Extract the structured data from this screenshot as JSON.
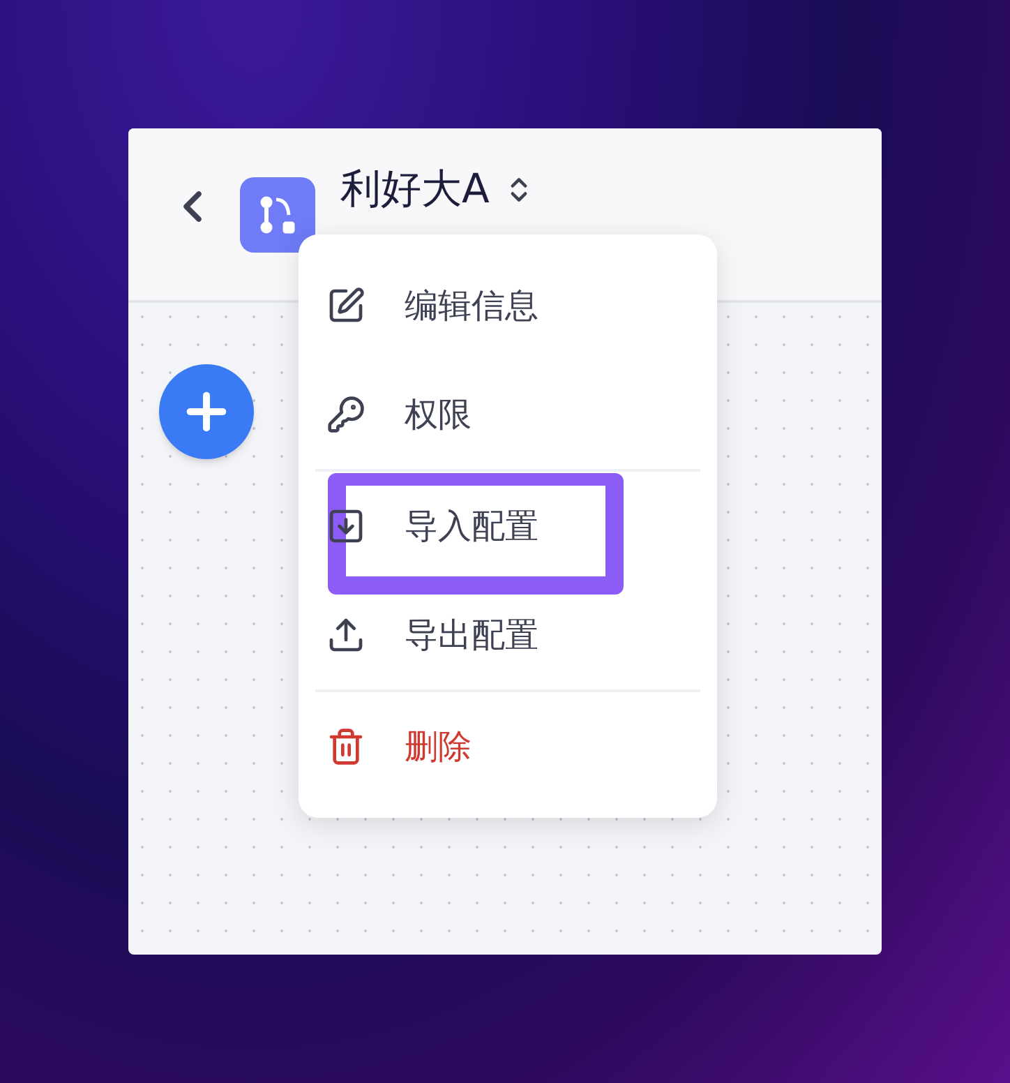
{
  "header": {
    "title": "利好大A"
  },
  "menu": {
    "groups": [
      {
        "items": [
          {
            "label": "编辑信息",
            "kind": "edit",
            "highlighted": false
          },
          {
            "label": "权限",
            "kind": "key",
            "highlighted": false
          }
        ]
      },
      {
        "items": [
          {
            "label": "导入配置",
            "kind": "import",
            "highlighted": true
          },
          {
            "label": "导出配置",
            "kind": "export",
            "highlighted": false
          }
        ]
      },
      {
        "items": [
          {
            "label": "删除",
            "kind": "delete",
            "highlighted": false
          }
        ]
      }
    ]
  }
}
